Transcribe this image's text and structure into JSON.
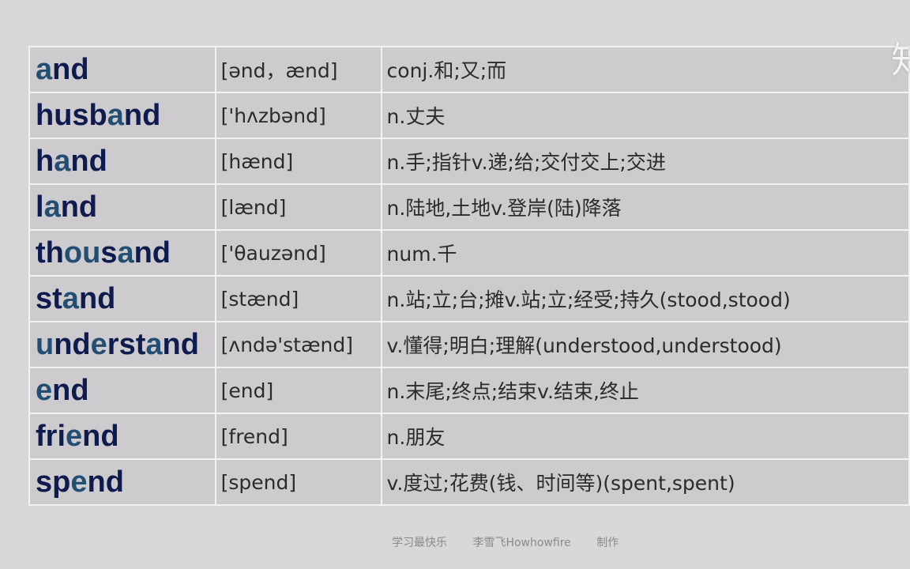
{
  "rows": [
    {
      "word": "and",
      "segments": [
        [
          "a",
          true
        ],
        [
          "nd",
          false
        ]
      ],
      "phonetic": "[ənd，ænd]",
      "meaning": "conj.和;又;而"
    },
    {
      "word": "husband",
      "segments": [
        [
          "husb",
          false
        ],
        [
          "a",
          true
        ],
        [
          "nd",
          false
        ]
      ],
      "phonetic": "['hʌzbənd]",
      "meaning": "n.丈夫"
    },
    {
      "word": "hand",
      "segments": [
        [
          "h",
          false
        ],
        [
          "a",
          true
        ],
        [
          "nd",
          false
        ]
      ],
      "phonetic": "[hænd]",
      "meaning": "n.手;指针v.递;给;交付交上;交进"
    },
    {
      "word": "land",
      "segments": [
        [
          "l",
          false
        ],
        [
          "a",
          true
        ],
        [
          "nd",
          false
        ]
      ],
      "phonetic": "[lænd]",
      "meaning": "n.陆地,土地v.登岸(陆)降落"
    },
    {
      "word": "thousand",
      "segments": [
        [
          "th",
          false
        ],
        [
          "ou",
          true
        ],
        [
          "s",
          false
        ],
        [
          "a",
          true
        ],
        [
          "nd",
          false
        ]
      ],
      "phonetic": "['θauzənd]",
      "meaning": "num.千"
    },
    {
      "word": "stand",
      "segments": [
        [
          "st",
          false
        ],
        [
          "a",
          true
        ],
        [
          "nd",
          false
        ]
      ],
      "phonetic": "[stænd]",
      "meaning": "n.站;立;台;摊v.站;立;经受;持久(stood,stood)"
    },
    {
      "word": "understand",
      "segments": [
        [
          "u",
          true
        ],
        [
          "nd",
          false
        ],
        [
          "e",
          true
        ],
        [
          "rst",
          false
        ],
        [
          "a",
          true
        ],
        [
          "nd",
          false
        ]
      ],
      "phonetic": "[ʌndə'stænd]",
      "meaning": "v.懂得;明白;理解(understood,understood)"
    },
    {
      "word": "end",
      "segments": [
        [
          "e",
          true
        ],
        [
          "nd",
          false
        ]
      ],
      "phonetic": "[end]",
      "meaning": "n.末尾;终点;结束v.结束,终止"
    },
    {
      "word": "friend",
      "segments": [
        [
          "fri",
          false
        ],
        [
          "e",
          true
        ],
        [
          "nd",
          false
        ]
      ],
      "phonetic": "[frend]",
      "meaning": "n.朋友"
    },
    {
      "word": "spend",
      "segments": [
        [
          "sp",
          false
        ],
        [
          "e",
          true
        ],
        [
          "nd",
          false
        ]
      ],
      "phonetic": "[spend]",
      "meaning": "v.度过;花费(钱、时间等)(spent,spent)"
    }
  ],
  "footer": {
    "slogan": "学习最快乐",
    "author": "李雪飞Howhowfire",
    "made": "制作"
  },
  "watermark": "知",
  "colors": {
    "word": "#0d1b4f",
    "highlight": "#234e74",
    "table_bg": "#cdcbcd",
    "page_bg": "#d8d8d8"
  }
}
